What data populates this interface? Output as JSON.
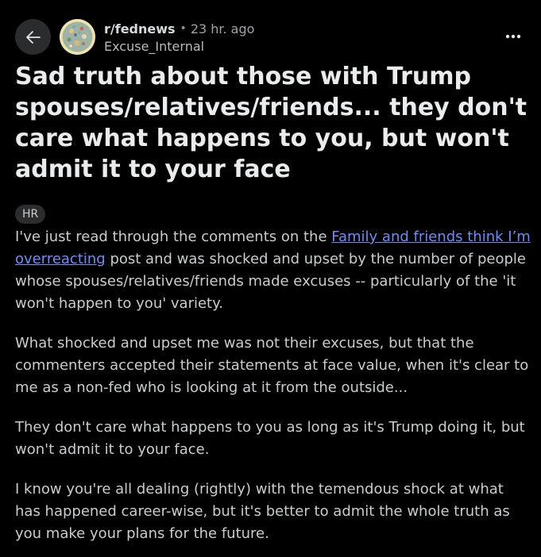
{
  "header": {
    "subreddit": "r/fednews",
    "separator": "•",
    "time": "23 hr. ago",
    "author": "Excuse_Internal"
  },
  "icons": {
    "back": "back-arrow-icon",
    "more": "more-options-icon",
    "avatar": "subreddit-avatar"
  },
  "post": {
    "title": "Sad truth about those with Trump spouses/relatives/friends... they don't care what happens to you, but won't admit it to your face",
    "flair": "HR",
    "paragraph1": {
      "before_link": "I've just read through the comments on the ",
      "link_text": "Family and friends think I’m overreacting",
      "after_link": " post and was shocked and upset by the number of people whose spouses/relatives/friends made excuses -- particularly of the 'it won't happen to you' variety."
    },
    "paragraph2": "What shocked and upset me was not their excuses, but that the commenters accepted their statements at face value, when it's clear to me as a non-fed who is looking at it from the outside...",
    "paragraph3": "They don't care what happens to you as long as it's Trump doing it, but won't admit it to your face.",
    "paragraph4": "I know you're all dealing (rightly) with the temendous shock at what has happened career-wise, but it's better to admit the whole truth as you make your plans for the future."
  },
  "colors": {
    "background": "#000000",
    "text": "#d7dadc",
    "link": "#6b8ef8",
    "button_bg": "#2a2c2e"
  }
}
